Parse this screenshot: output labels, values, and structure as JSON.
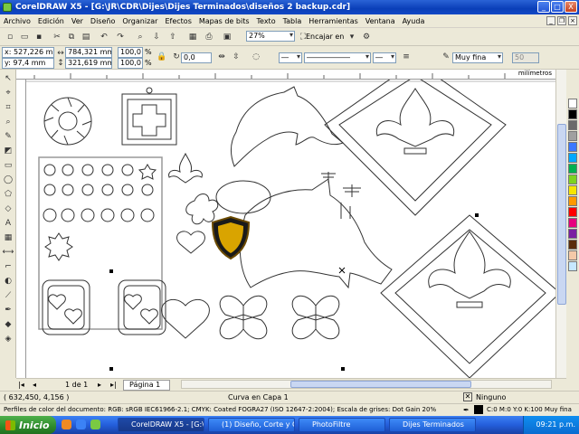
{
  "window": {
    "title": "CorelDRAW X5 - [G:\\JR\\CDR\\Dijes\\Dijes Terminados\\diseños 2 backup.cdr]",
    "controls": {
      "minimize": "_",
      "maximize": "□",
      "close": "X"
    }
  },
  "menu": [
    "Archivo",
    "Edición",
    "Ver",
    "Diseño",
    "Organizar",
    "Efectos",
    "Mapas de bits",
    "Texto",
    "Tabla",
    "Herramientas",
    "Ventana",
    "Ayuda"
  ],
  "toolbar_std": {
    "zoom": "27%",
    "snap": "Encajar en"
  },
  "propbar": {
    "x": "x: 527,226 mm",
    "y": "y: 97,4 mm",
    "width": "784,321 mm",
    "height": "321,619 mm",
    "scale_w": "100,0",
    "scale_h": "100,0",
    "scale_unit": "%",
    "angle": "0,0",
    "outline_width": "Muy fina",
    "ruler_units": "milímetros",
    "gray_field": "50"
  },
  "pagebar": {
    "page_count": "1 de 1",
    "page_tab": "Página 1"
  },
  "status": {
    "cursor": "( 632,450, 4,156 )",
    "object_info": "Curva en Capa 1",
    "fill": "Ninguno",
    "profile": "Perfiles de color del documento: RGB: sRGB IEC61966-2.1; CMYK: Coated FOGRA27 (ISO 12647-2:2004); Escala de grises: Dot Gain 20%",
    "outline": "C:0 M:0 Y:0 K:100  Muy fina"
  },
  "taskbar": {
    "start": "Inicio",
    "tasks": [
      "CorelDRAW X5 - [G:\\...",
      "(1) Diseño, Corte y G...",
      "PhotoFiltre",
      "Dijes Terminados"
    ],
    "clock": "09:21 p.m."
  },
  "palette": [
    "#ffffff",
    "#000000",
    "#6b6b6b",
    "#a0a0a0",
    "#3a78ff",
    "#00a8ff",
    "#00b050",
    "#7ed321",
    "#f6e600",
    "#ff9a00",
    "#ff0000",
    "#e6007e",
    "#7a1fa2",
    "#5a2d0c",
    "#f4c9a8",
    "#c6e8ff"
  ],
  "colors": {
    "accent": "#0a3fb8",
    "canvas": "#ffffff"
  }
}
